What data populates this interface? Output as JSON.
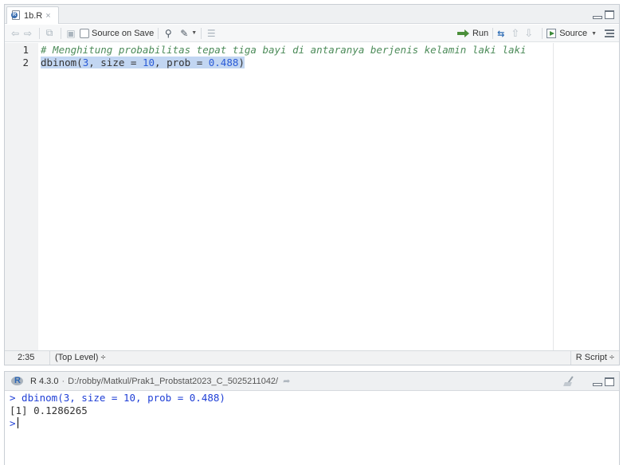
{
  "editor": {
    "tab": {
      "name": "1b.R",
      "close": "×"
    },
    "toolbar": {
      "source_on_save_label": "Source on Save",
      "run_label": "Run",
      "source_label": "Source"
    },
    "lines": {
      "n1": "1",
      "n2": "2",
      "comment": "# Menghitung probabilitas tepat tiga bayi di antaranya berjenis kelamin laki laki",
      "code_fn": "dbinom(",
      "code_n3": "3",
      "code_mid1": ", size = ",
      "code_n10": "10",
      "code_mid2": ", prob = ",
      "code_p": "0.488",
      "code_end": ")"
    },
    "status": {
      "position": "2:35",
      "scope": "(Top Level) ÷",
      "file_type": "R Script ÷"
    }
  },
  "console": {
    "version": "R 4.3.0",
    "separator": "·",
    "path": "D:/robby/Matkul/Prak1_Probstat2023_C_5025211042/",
    "lines": {
      "input": "> dbinom(3, size = 10, prob = 0.488)",
      "output": "[1] 0.1286265",
      "prompt": ">"
    }
  },
  "colors": {
    "comment": "#4d8c5a",
    "selection": "#c2d6f2",
    "number": "#2a5bd7",
    "console_input": "#1f3fd6"
  }
}
